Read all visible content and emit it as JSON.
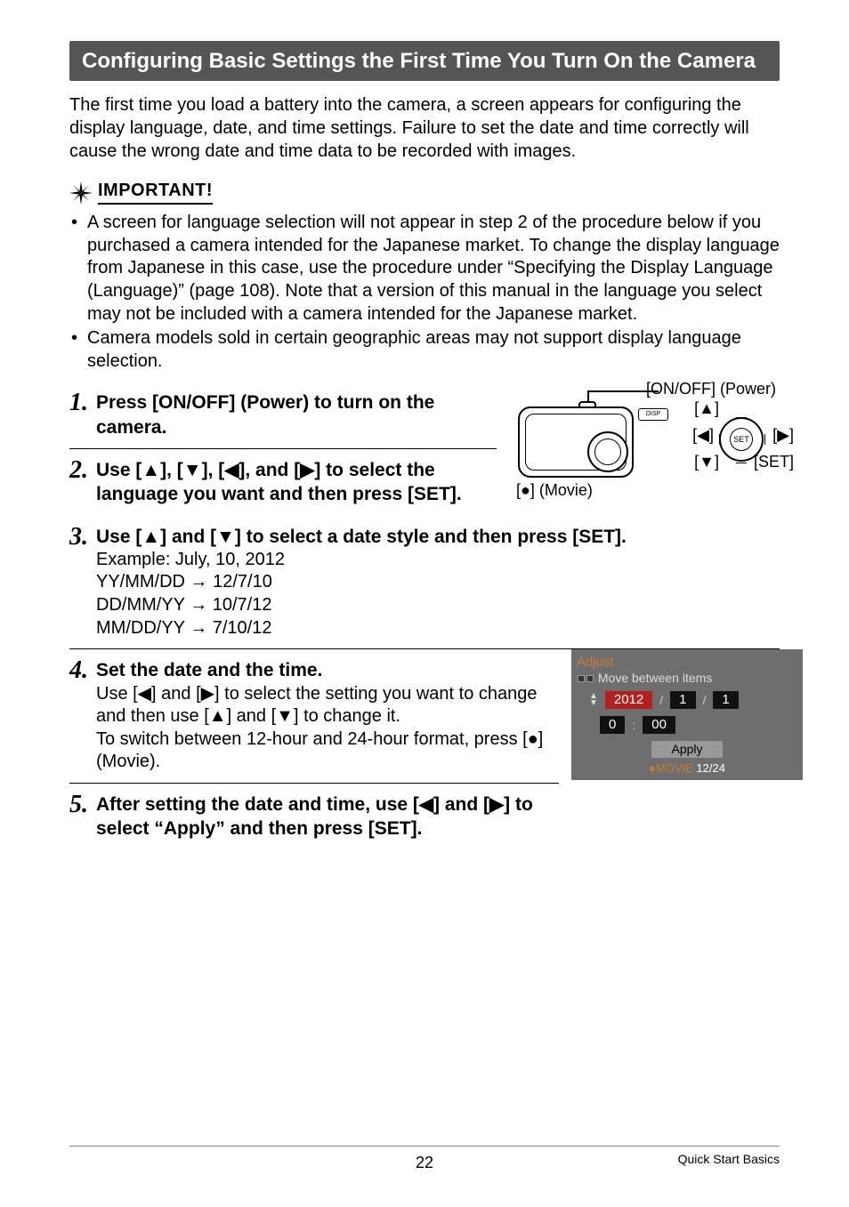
{
  "header": "Configuring Basic Settings the First Time You Turn On the Camera",
  "intro": "The first time you load a battery into the camera, a screen appears for configuring the display language, date, and time settings. Failure to set the date and time correctly will cause the wrong date and time data to be recorded with images.",
  "important_label": "IMPORTANT!",
  "bullet1": "A screen for language selection will not appear in step 2 of the procedure below if you purchased a camera intended for the Japanese market. To change the display language from Japanese in this case, use the procedure under “Specifying the Display Language (Language)” (page 108). Note that a version of this manual in the language you select may not be included with a camera intended for the Japanese market.",
  "bullet2": "Camera models sold in certain geographic areas may not support display language selection.",
  "step1": {
    "num": "1.",
    "heading": "Press [ON/OFF] (Power) to turn on the camera."
  },
  "step2": {
    "num": "2.",
    "heading": "Use [▲], [▼], [◀], and [▶] to select the language you want and then press [SET]."
  },
  "step3": {
    "num": "3.",
    "heading": "Use [▲] and [▼] to select a date style and then press [SET].",
    "ex": "Example: July, 10, 2012",
    "l1": "YY/MM/DD → 12/7/10",
    "l2": "DD/MM/YY → 10/7/12",
    "l3": "MM/DD/YY → 7/10/12"
  },
  "step4": {
    "num": "4.",
    "heading": "Set the date and the time.",
    "b1": "Use [◀] and [▶] to select the setting you want to change and then use [▲] and [▼] to change it.",
    "b2": "To switch between 12-hour and 24-hour format, press [●] (Movie)."
  },
  "step5": {
    "num": "5.",
    "heading": "After setting the date and time, use [◀] and [▶] to select “Apply” and then press [SET]."
  },
  "diagram": {
    "onoff": "[ON/OFF] (Power)",
    "up": "[▲]",
    "down": "[▼]",
    "left": "[◀]",
    "right": "[▶]",
    "set": "[SET]",
    "movie": "[●] (Movie)",
    "disp": "DISP",
    "setbtn": "SET"
  },
  "adjust": {
    "title": "Adjust",
    "sub": "Move between items",
    "year": "2012",
    "m": "1",
    "d": "1",
    "hh": "0",
    "mm": "00",
    "apply": "Apply",
    "movie_lbl": "●MOVIE",
    "toggle": "12/24"
  },
  "footer": {
    "page": "22",
    "right": "Quick Start Basics"
  }
}
